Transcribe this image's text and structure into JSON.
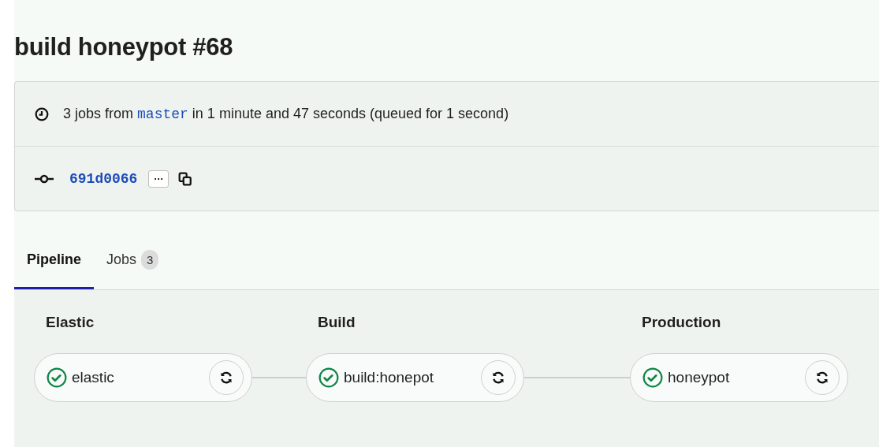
{
  "title": "build honeypot #68",
  "summary": {
    "prefix": "3 jobs from",
    "branch": "master",
    "suffix": "in 1 minute and 47 seconds (queued for 1 second)"
  },
  "commit": {
    "sha": "691d0066",
    "more": "···"
  },
  "tabs": [
    {
      "label": "Pipeline",
      "selected": true
    },
    {
      "label": "Jobs",
      "count": "3",
      "selected": false
    }
  ],
  "stages": [
    {
      "name": "Elastic",
      "jobs": [
        {
          "name": "elastic",
          "kind": "success"
        }
      ]
    },
    {
      "name": "Build",
      "jobs": [
        {
          "name": "build:honepot",
          "kind": "success"
        }
      ]
    },
    {
      "name": "Production",
      "jobs": [
        {
          "name": "honeypot",
          "kind": "success"
        }
      ]
    }
  ]
}
